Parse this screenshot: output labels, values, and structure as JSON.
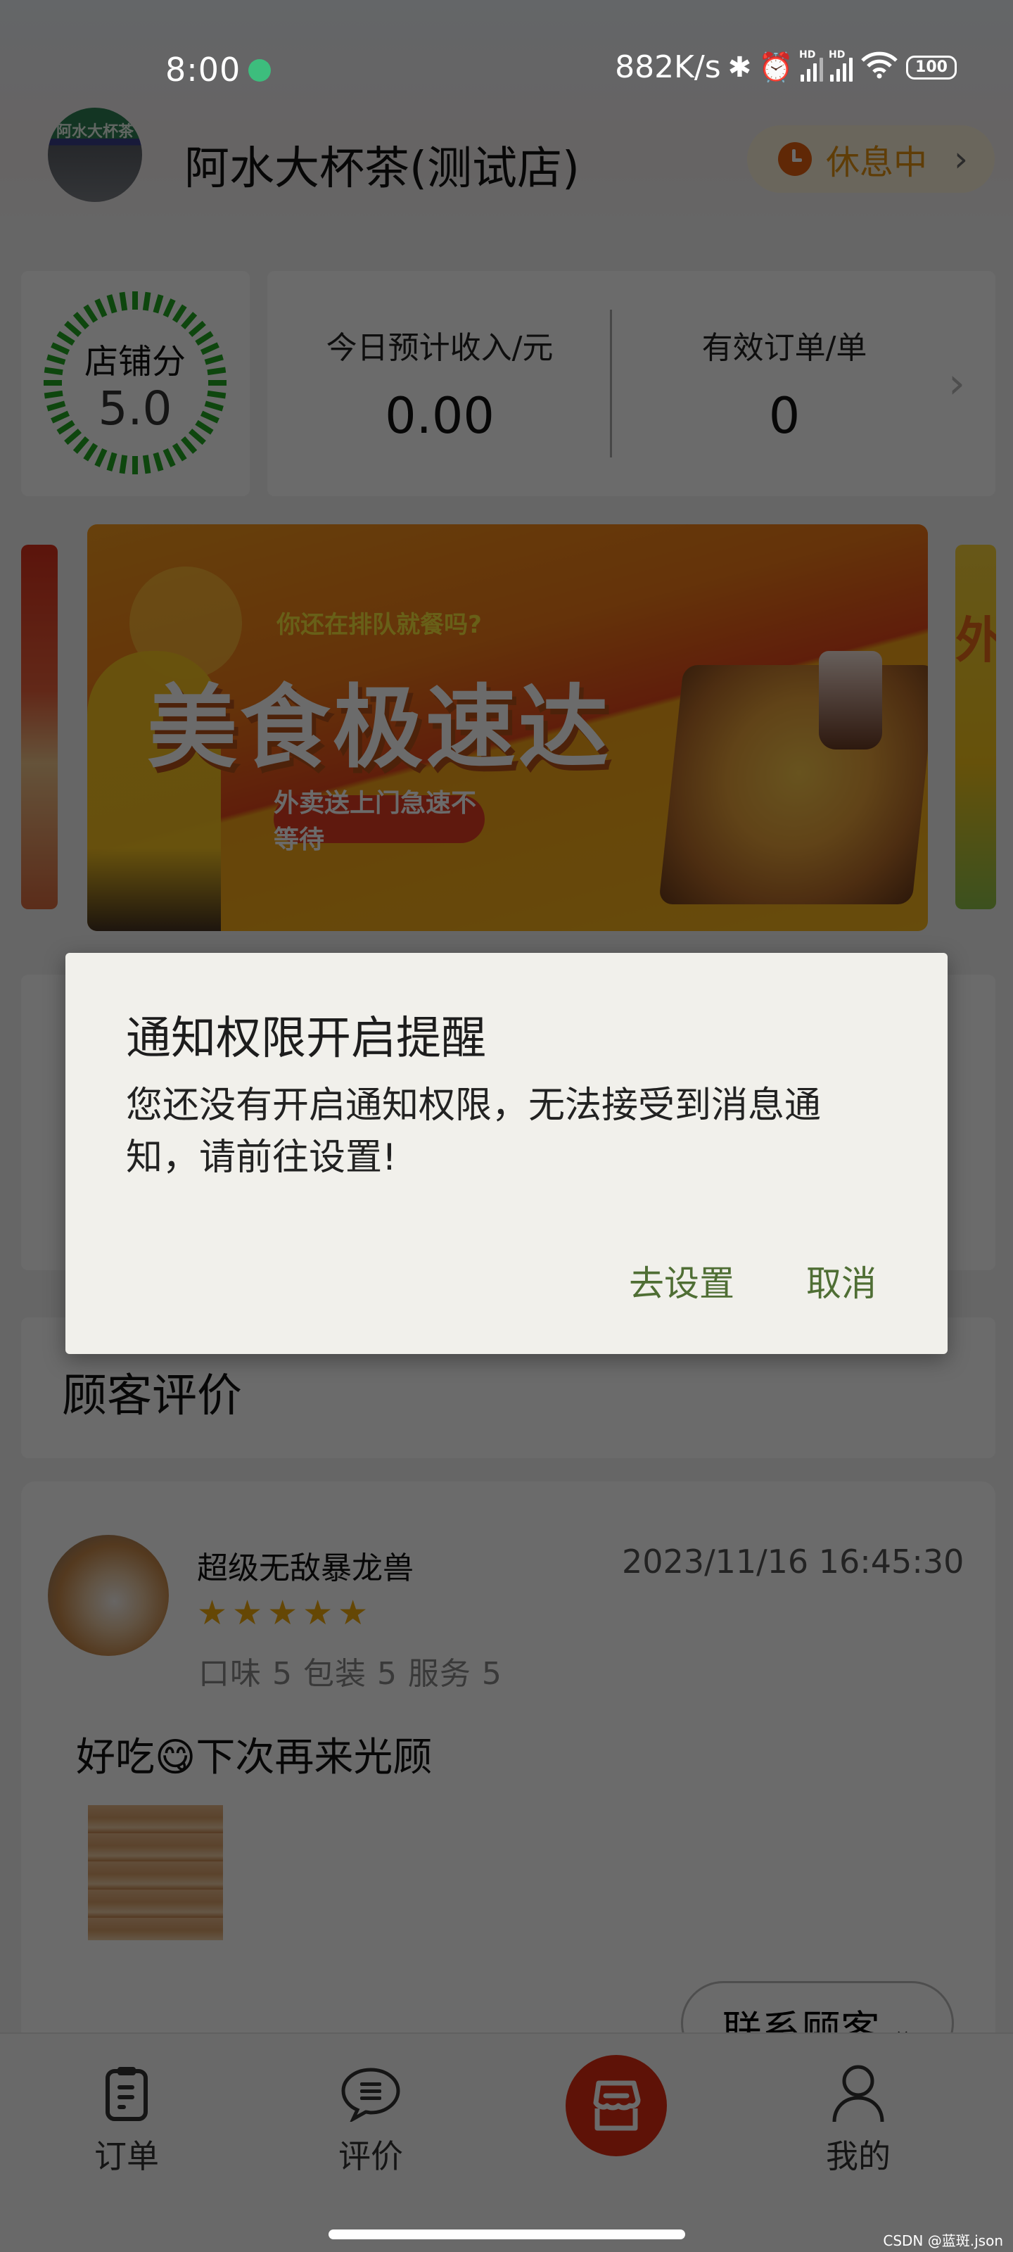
{
  "status_bar": {
    "time": "8:00",
    "notification_icon": "wechat-icon",
    "net_speed": "882K/s",
    "icons": [
      "bluetooth-icon",
      "alarm-icon",
      "signal-hd-icon",
      "signal-hd-icon",
      "wifi-icon"
    ],
    "signal_badge": "HD",
    "battery": "100"
  },
  "header": {
    "store_avatar_text": "阿水大杯茶",
    "store_name": "阿水大杯茶(测试店)",
    "status": {
      "label": "休息中",
      "icon": "clock-icon",
      "chevron": "›",
      "color": "#e39212"
    }
  },
  "stats": {
    "score_label": "店铺分",
    "score_value": "5.0",
    "score_ring_color": "#22a822",
    "items": [
      {
        "label": "今日预计收入/元",
        "value": "0.00"
      },
      {
        "label": "有效订单/单",
        "value": "0"
      }
    ],
    "chevron": "›"
  },
  "banner": {
    "subtitle": "你还在排队就餐吗?",
    "title": "美食极速达",
    "tagline": "外卖送上门急速不等待",
    "right_peek_text": "外"
  },
  "reviews": {
    "section_title": "顾客评价",
    "items": [
      {
        "name": "超级无敌暴龙兽",
        "time": "2023/11/16 16:45:30",
        "rating": 5,
        "rating_max": 5,
        "sub_ratings": "口味 5 包装 5 服务 5",
        "text": "好吃😋下次再来光顾",
        "contact_label": "联系顾客",
        "contact_chevron": "⌄"
      }
    ]
  },
  "tab_bar": {
    "items": [
      {
        "label": "订单",
        "icon": "order-clipboard-icon"
      },
      {
        "label": "评价",
        "icon": "comment-bubble-icon"
      },
      {
        "label": "",
        "icon": "store-icon",
        "active": true
      },
      {
        "label": "我的",
        "icon": "user-icon"
      }
    ],
    "active_color": "#e02c12"
  },
  "dialog": {
    "title": "通知权限开启提醒",
    "message": "您还没有开启通知权限，无法接受到消息通知，请前往设置!",
    "confirm_label": "去设置",
    "cancel_label": "取消",
    "button_color": "#4f6e34"
  },
  "watermark": "CSDN @蓝斑.json"
}
